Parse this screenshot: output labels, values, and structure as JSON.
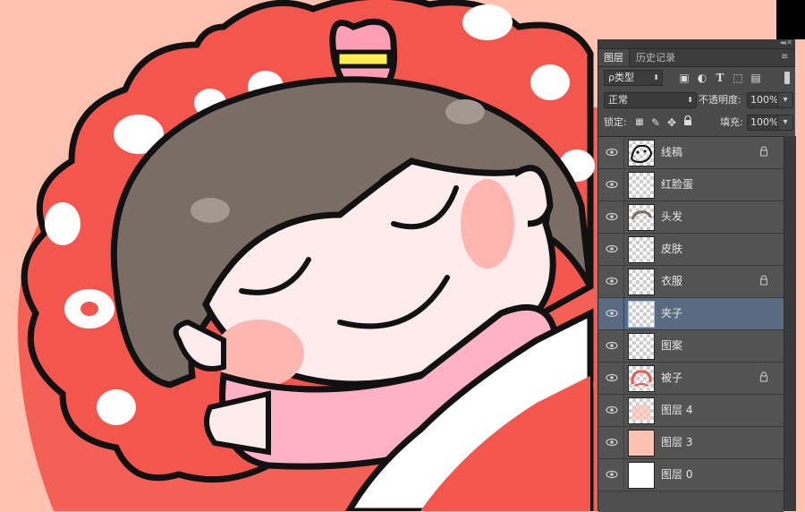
{
  "tabs": [
    {
      "label": "图层",
      "active": true
    },
    {
      "label": "历史记录",
      "active": false
    }
  ],
  "filter": {
    "label": "ρ类型"
  },
  "blend_mode": {
    "value": "正常"
  },
  "opacity": {
    "label": "不透明度:",
    "value": "100%"
  },
  "lock": {
    "label": "锁定:"
  },
  "fill": {
    "label": "填充:",
    "value": "100%"
  },
  "layers": [
    {
      "name": "线稿",
      "locked": true,
      "selected": false
    },
    {
      "name": "红脸蛋",
      "locked": false,
      "selected": false
    },
    {
      "name": "头发",
      "locked": false,
      "selected": false
    },
    {
      "name": "皮肤",
      "locked": false,
      "selected": false
    },
    {
      "name": "衣服",
      "locked": true,
      "selected": false
    },
    {
      "name": "夹子",
      "locked": false,
      "selected": true
    },
    {
      "name": "图案",
      "locked": false,
      "selected": false
    },
    {
      "name": "被子",
      "locked": true,
      "selected": false
    },
    {
      "name": "图层 4",
      "locked": false,
      "selected": false
    },
    {
      "name": "图层 3",
      "locked": false,
      "selected": false
    },
    {
      "name": "图层 0",
      "locked": false,
      "selected": false
    }
  ],
  "colors": {
    "background": "#ffc2b1",
    "blanket": "#f2564d",
    "hair": "#7a6d65",
    "skin": "#fdeceb",
    "cheek": "#ffb5b0",
    "clothes": "#ffb2c6",
    "clip_yellow": "#ffee50",
    "panel": "#4a4a4a",
    "selected_layer": "#5a6a82"
  }
}
